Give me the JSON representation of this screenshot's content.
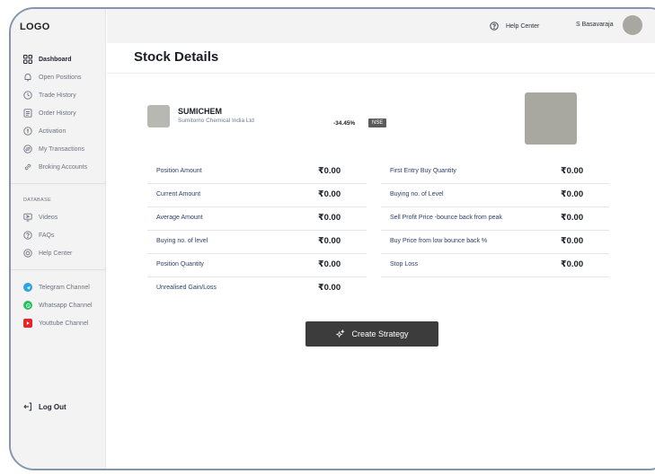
{
  "app": {
    "logo": "LOGO"
  },
  "header": {
    "help_label": "Help Center",
    "user_name": "S Basavaraja"
  },
  "sidebar": {
    "nav": [
      {
        "label": "Dashboard",
        "icon": "grid-icon",
        "active": true
      },
      {
        "label": "Open Positions",
        "icon": "bell-icon"
      },
      {
        "label": "Trade History",
        "icon": "clock-icon"
      },
      {
        "label": "Order History",
        "icon": "document-icon"
      },
      {
        "label": "Activation",
        "icon": "coin-icon"
      },
      {
        "label": "My Transactions",
        "icon": "transactions-icon"
      },
      {
        "label": "Broking Accounts",
        "icon": "link-icon"
      }
    ],
    "section_label": "DATABASE",
    "database": [
      {
        "label": "Videos",
        "icon": "video-icon"
      },
      {
        "label": "FAQs",
        "icon": "question-icon"
      },
      {
        "label": "Help Center",
        "icon": "help-icon"
      }
    ],
    "channels": [
      {
        "label": "Telegram Channel",
        "icon": "telegram-icon",
        "color": "#2aa3df"
      },
      {
        "label": "Whatsapp Channel",
        "icon": "whatsapp-icon",
        "color": "#25c05a"
      },
      {
        "label": "Youttube Channel",
        "icon": "youtube-icon",
        "color": "#e5252a"
      }
    ],
    "logout": "Log Out"
  },
  "page": {
    "title": "Stock Details"
  },
  "stock": {
    "symbol": "SUMICHEM",
    "company": "Sumitomo Chemical India Ltd",
    "change": "-34.45%",
    "exchange": "NSE"
  },
  "metrics_left": [
    {
      "label": "Position Amount",
      "value": "₹0.00"
    },
    {
      "label": "Current Amount",
      "value": "₹0.00"
    },
    {
      "label": "Average Amount",
      "value": "₹0.00"
    },
    {
      "label": "Buying no. of level",
      "value": "₹0.00"
    },
    {
      "label": "Position Quantity",
      "value": "₹0.00"
    },
    {
      "label": "Unrealised Gain/Loss",
      "value": "₹0.00"
    }
  ],
  "metrics_right": [
    {
      "label": "First Entry Buy Quantity",
      "value": "₹0.00"
    },
    {
      "label": "Buying no. of Level",
      "value": "₹0.00"
    },
    {
      "label": "Sell Profit Price -bounce back from peak",
      "value": "₹0.00"
    },
    {
      "label": "Buy Price from low bounce back %",
      "value": "₹0.00"
    },
    {
      "label": "Stop Loss",
      "value": "₹0.00"
    }
  ],
  "actions": {
    "create_strategy": "Create Strategy"
  },
  "colors": {
    "accent_dark": "#3c3c3c",
    "label_blue": "#2c3e66",
    "frame_border": "#8396ad"
  }
}
